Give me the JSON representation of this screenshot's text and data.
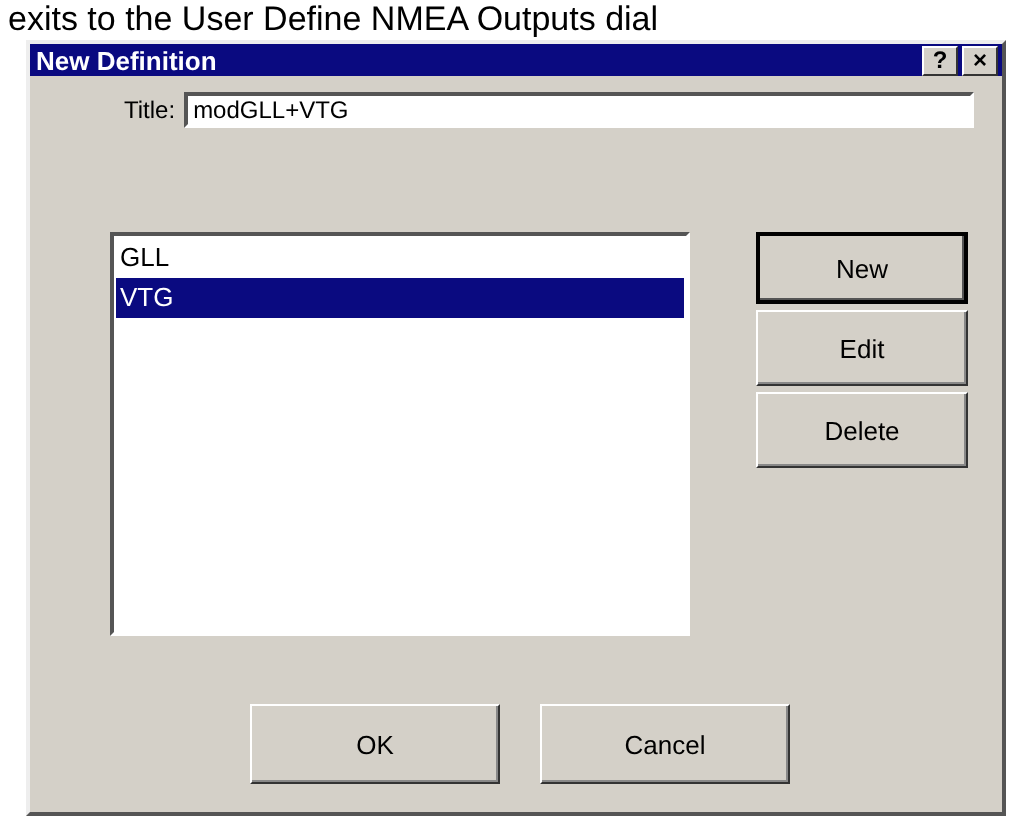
{
  "caption": "exits to the User Define NMEA Outputs dial",
  "window": {
    "title": "New Definition",
    "help_button": "?",
    "close_button": "×"
  },
  "title_field": {
    "label": "Title:",
    "value": "modGLL+VTG"
  },
  "list": [
    {
      "label": "GLL",
      "selected": false
    },
    {
      "label": "VTG",
      "selected": true
    }
  ],
  "side_buttons": [
    {
      "label": "New",
      "default": true
    },
    {
      "label": "Edit",
      "default": false
    },
    {
      "label": "Delete",
      "default": false
    }
  ],
  "buttons": [
    "OK",
    "Cancel"
  ]
}
